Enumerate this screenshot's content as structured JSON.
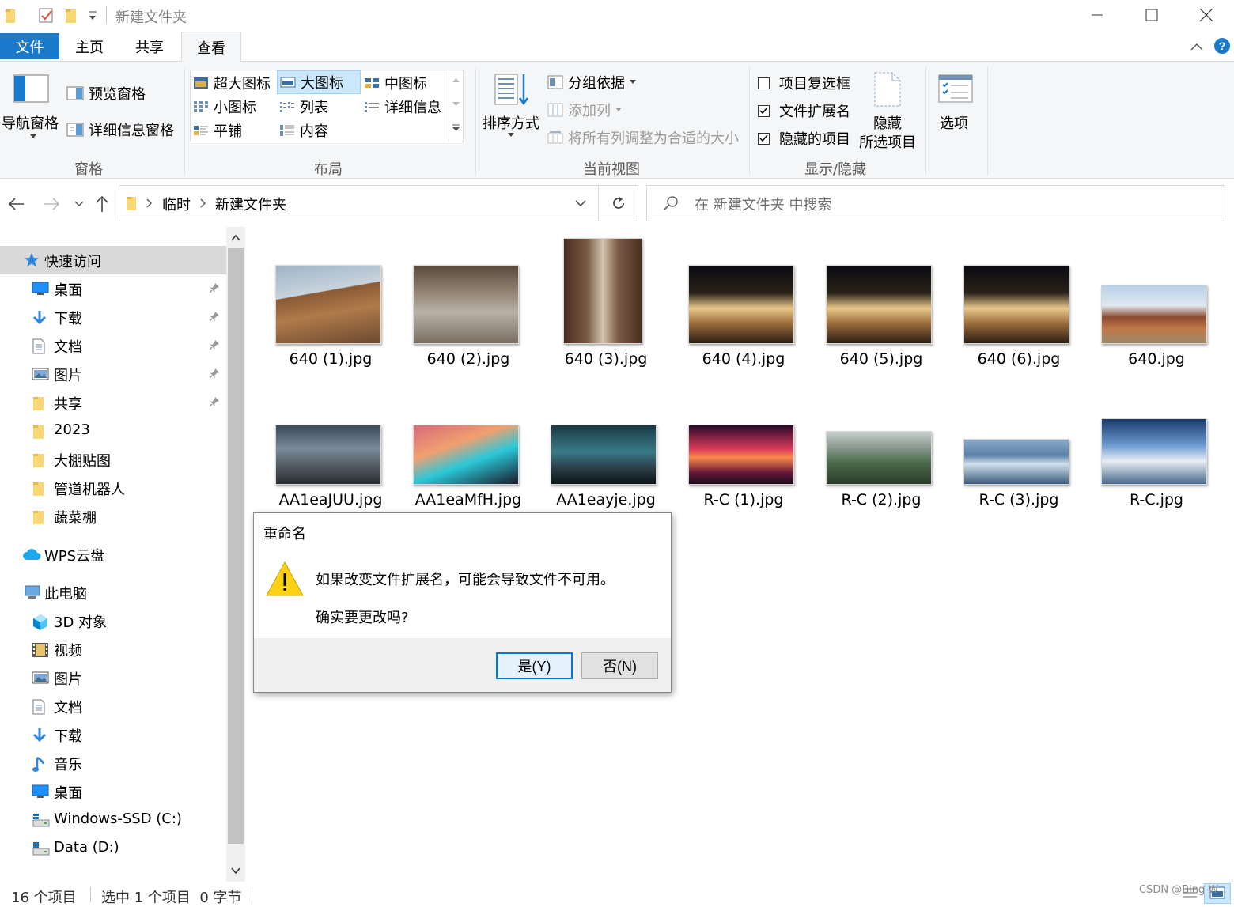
{
  "window": {
    "title": "新建文件夹",
    "minimize_icon": "minimize-icon",
    "maximize_icon": "maximize-icon",
    "close_icon": "close-icon"
  },
  "ribbon_tabs": [
    {
      "label": "文件",
      "active": false
    },
    {
      "label": "主页",
      "active": false
    },
    {
      "label": "共享",
      "active": false
    },
    {
      "label": "查看",
      "active": true
    }
  ],
  "ribbon": {
    "panes": {
      "nav_pane": "导航窗格",
      "preview_pane": "预览窗格",
      "details_pane": "详细信息窗格",
      "group_label": "窗格"
    },
    "layout": {
      "options": [
        "超大图标",
        "大图标",
        "中图标",
        "小图标",
        "列表",
        "详细信息",
        "平铺",
        "内容"
      ],
      "selected": "大图标",
      "group_label": "布局"
    },
    "current_view": {
      "sort_by": "排序方式",
      "group_by": "分组依据",
      "add_columns": "添加列",
      "size_columns": "将所有列调整为合适的大小",
      "group_label": "当前视图"
    },
    "show_hide": {
      "item_checkboxes": {
        "label": "项目复选框",
        "checked": false
      },
      "file_extensions": {
        "label": "文件扩展名",
        "checked": true
      },
      "hidden_items": {
        "label": "隐藏的项目",
        "checked": true
      },
      "hide_selected_line1": "隐藏",
      "hide_selected_line2": "所选项目",
      "group_label": "显示/隐藏"
    },
    "options": "选项"
  },
  "address": {
    "crumbs": [
      "临时",
      "新建文件夹"
    ],
    "search_placeholder": "在 新建文件夹 中搜索"
  },
  "sidebar": {
    "quick_access": "快速访问",
    "quick_items": [
      {
        "label": "桌面",
        "icon": "desktop-icon",
        "pinned": true
      },
      {
        "label": "下载",
        "icon": "download-icon",
        "pinned": true
      },
      {
        "label": "文档",
        "icon": "document-icon",
        "pinned": true
      },
      {
        "label": "图片",
        "icon": "pictures-icon",
        "pinned": true
      },
      {
        "label": "共享",
        "icon": "folder-icon",
        "pinned": true
      },
      {
        "label": "2023",
        "icon": "folder-icon",
        "pinned": false
      },
      {
        "label": "大棚贴图",
        "icon": "folder-icon",
        "pinned": false
      },
      {
        "label": "管道机器人",
        "icon": "folder-icon",
        "pinned": false
      },
      {
        "label": "蔬菜棚",
        "icon": "folder-icon",
        "pinned": false
      }
    ],
    "wps_cloud": "WPS云盘",
    "this_pc": "此电脑",
    "pc_items": [
      {
        "label": "3D 对象",
        "icon": "3d-objects-icon"
      },
      {
        "label": "视频",
        "icon": "video-icon"
      },
      {
        "label": "图片",
        "icon": "pictures-icon"
      },
      {
        "label": "文档",
        "icon": "document-icon"
      },
      {
        "label": "下载",
        "icon": "download-icon"
      },
      {
        "label": "音乐",
        "icon": "music-icon"
      },
      {
        "label": "桌面",
        "icon": "desktop-icon"
      },
      {
        "label": "Windows-SSD (C:)",
        "icon": "drive-icon"
      },
      {
        "label": "Data (D:)",
        "icon": "drive-icon"
      }
    ]
  },
  "files": [
    {
      "name": "640 (1).jpg",
      "theme": "construction"
    },
    {
      "name": "640 (2).jpg",
      "theme": "columns"
    },
    {
      "name": "640 (3).jpg",
      "theme": "corridor"
    },
    {
      "name": "640 (4).jpg",
      "theme": "palace-night"
    },
    {
      "name": "640 (5).jpg",
      "theme": "palace-night"
    },
    {
      "name": "640 (6).jpg",
      "theme": "palace-night"
    },
    {
      "name": "640.jpg",
      "theme": "pavilion"
    },
    {
      "name": "AA1eaJUU.jpg",
      "theme": "city-dusk"
    },
    {
      "name": "AA1eaMfH.jpg",
      "theme": "car-neon"
    },
    {
      "name": "AA1eayje.jpg",
      "theme": "city-teal"
    },
    {
      "name": "R-C (1).jpg",
      "theme": "sunset-red"
    },
    {
      "name": "R-C (2).jpg",
      "theme": "cliffs"
    },
    {
      "name": "R-C (3).jpg",
      "theme": "ocean"
    },
    {
      "name": "R-C.jpg",
      "theme": "clouds"
    }
  ],
  "dialog": {
    "title": "重命名",
    "message": "如果改变文件扩展名，可能会导致文件不可用。",
    "question": "确实要更改吗?",
    "yes": "是(Y)",
    "no": "否(N)",
    "icon": "warning-icon"
  },
  "status": {
    "count": "16 个项目",
    "selection": "选中 1 个项目  0 字节"
  },
  "watermark": "CSDN @Bing-W"
}
